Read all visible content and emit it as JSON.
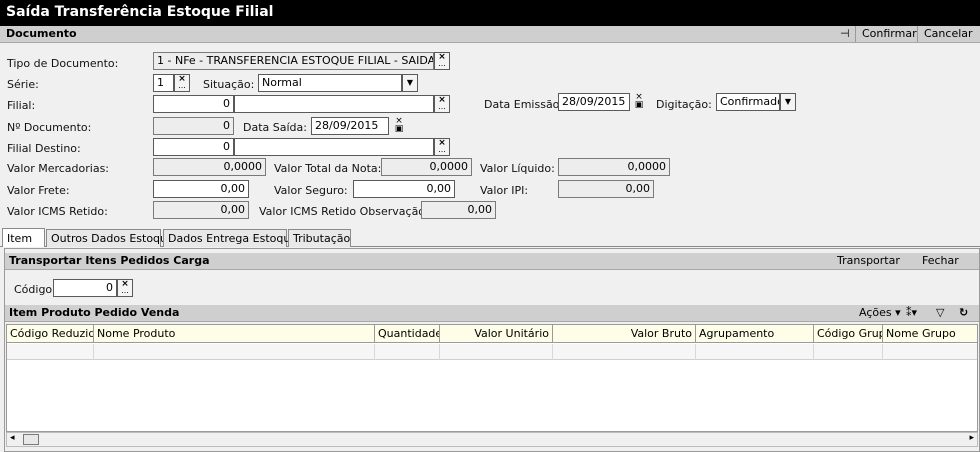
{
  "window": {
    "title": "Saída Transferência Estoque Filial"
  },
  "documento": {
    "section_title": "Documento",
    "pin_icon": "pin-icon",
    "confirmar": "Confirmar",
    "cancelar": "Cancelar"
  },
  "form": {
    "tipo_documento": {
      "label": "Tipo de Documento:",
      "value": "1 - NFe - TRANSFERENCIA ESTOQUE FILIAL - SAIDA"
    },
    "serie": {
      "label": "Série:",
      "value": "1"
    },
    "situacao": {
      "label": "Situação:",
      "value": "Normal"
    },
    "filial": {
      "label": "Filial:",
      "code": "0",
      "name": ""
    },
    "data_emissao": {
      "label": "Data Emissão:",
      "value": "28/09/2015"
    },
    "digitacao": {
      "label": "Digitação:",
      "value": "Confirmado"
    },
    "nr_documento": {
      "label": "Nº Documento:",
      "value": "0"
    },
    "data_saida": {
      "label": "Data Saída:",
      "value": "28/09/2015"
    },
    "filial_destino": {
      "label": "Filial Destino:",
      "code": "0",
      "name": ""
    },
    "valor_mercadorias": {
      "label": "Valor Mercadorias:",
      "value": "0,0000"
    },
    "valor_total_nota": {
      "label": "Valor Total da Nota:",
      "value": "0,0000"
    },
    "valor_liquido": {
      "label": "Valor Líquido:",
      "value": "0,0000"
    },
    "valor_frete": {
      "label": "Valor Frete:",
      "value": "0,00"
    },
    "valor_seguro": {
      "label": "Valor Seguro:",
      "value": "0,00"
    },
    "valor_ipi": {
      "label": "Valor IPI:",
      "value": "0,00"
    },
    "valor_icms_retido": {
      "label": "Valor ICMS Retido:",
      "value": "0,00"
    },
    "valor_icms_retido_obs": {
      "label": "Valor ICMS Retido Observação:",
      "value": "0,00"
    }
  },
  "tabs": [
    {
      "label": "Item"
    },
    {
      "label": "Outros Dados Estoque"
    },
    {
      "label": "Dados Entrega Estoque"
    },
    {
      "label": "Tributação"
    }
  ],
  "transportar": {
    "title": "Transportar Itens Pedidos Carga",
    "transportar_btn": "Transportar",
    "fechar_btn": "Fechar",
    "codigo_label": "Código:",
    "codigo_value": "0"
  },
  "itens": {
    "title": "Item Produto Pedido Venda",
    "acoes": "Ações",
    "columns": [
      "Código Reduzido",
      "Nome Produto",
      "Quantidade",
      "Valor Unitário",
      "Valor Bruto",
      "Agrupamento",
      "Código Grupo",
      "Nome Grupo"
    ]
  }
}
